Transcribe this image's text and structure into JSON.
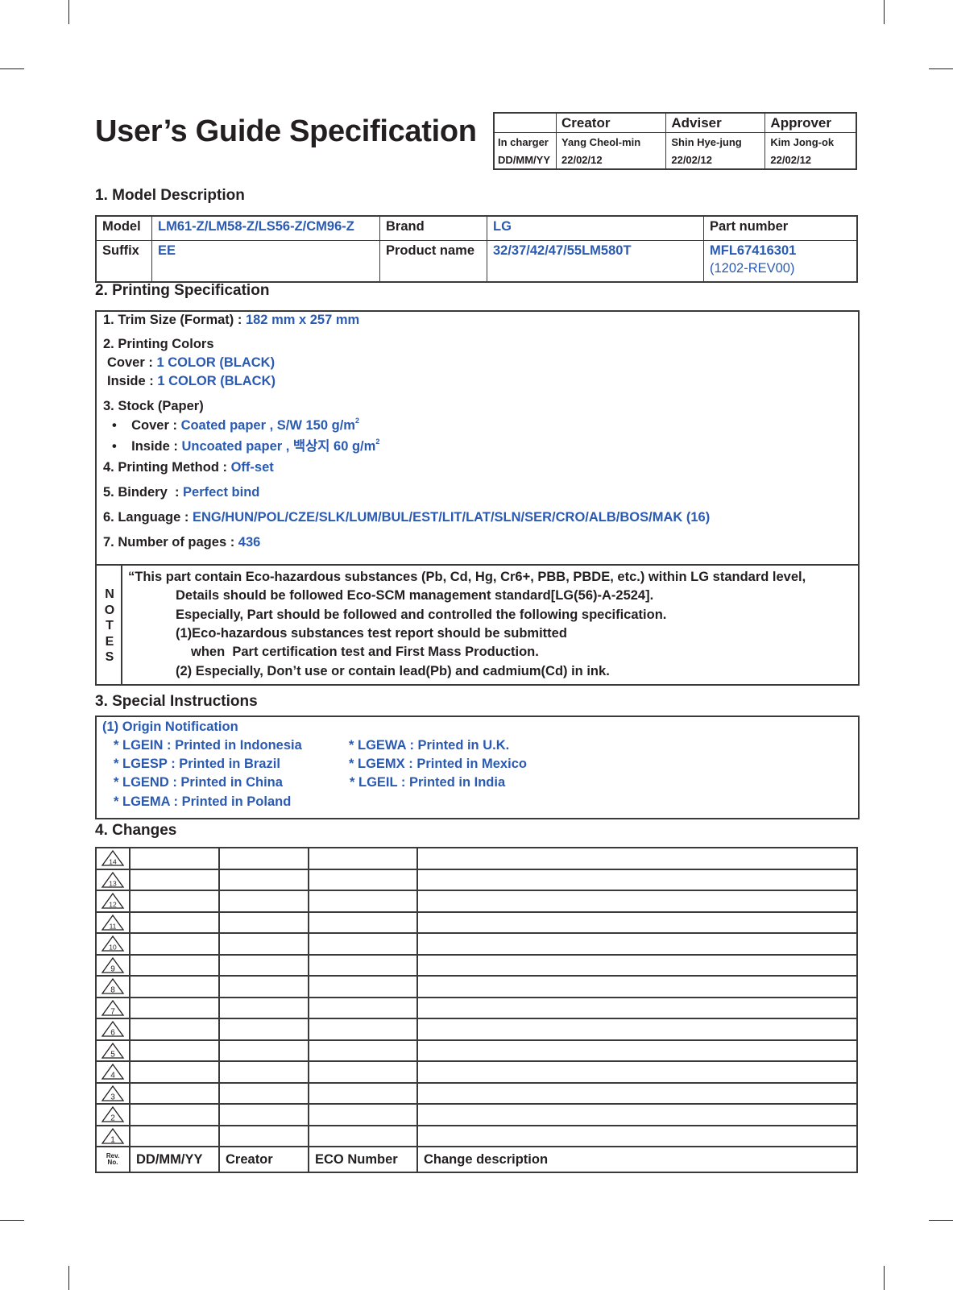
{
  "document": {
    "title": "User’s Guide Specification"
  },
  "approval": {
    "columns": [
      "",
      "Creator",
      "Adviser",
      "Approver"
    ],
    "rows": [
      {
        "label": "In charger",
        "creator": "Yang Cheol-min",
        "adviser": "Shin Hye-jung",
        "approver": "Kim Jong-ok"
      },
      {
        "label": "DD/MM/YY",
        "creator": "22/02/12",
        "adviser": "22/02/12",
        "approver": "22/02/12"
      }
    ]
  },
  "model_description": {
    "heading": "1. Model Description",
    "model_label": "Model",
    "model_value": "LM61-Z/LM58-Z/LS56-Z/CM96-Z",
    "brand_label": "Brand",
    "brand_value": "LG",
    "part_number_label": "Part number",
    "suffix_label": "Suffix",
    "suffix_value": "EE",
    "product_name_label": "Product name",
    "product_name_value": "32/37/42/47/55LM580T",
    "part_number_value": "MFL67416301",
    "part_number_rev": "(1202-REV00)"
  },
  "printing_spec": {
    "heading": "2. Printing Specification",
    "trim_label": "1. Trim Size (Format) : ",
    "trim_value": "182 mm x 257 mm",
    "colors_label": "2. Printing Colors",
    "cover_color_label": "Cover : ",
    "cover_color_value": "1 COLOR (BLACK)",
    "inside_color_label": "Inside : ",
    "inside_color_value": "1 COLOR (BLACK)",
    "stock_label": "3. Stock (Paper)",
    "stock_cover_label": "Cover : ",
    "stock_cover_value": "Coated paper , S/W 150 g/m",
    "stock_inside_label": "Inside : ",
    "stock_inside_value": "Uncoated paper , 백상지 60 g/m",
    "stock_unit_sup": "2",
    "bullet": "•",
    "method_label": "4. Printing Method : ",
    "method_value": "Off-set",
    "bindery_label": "5. Bindery  : ",
    "bindery_value": "Perfect bind",
    "language_label": "6. Language : ",
    "language_value": "ENG/HUN/POL/CZE/SLK/LUM/BUL/EST/LIT/LAT/SLN/SER/CRO/ALB/BOS/MAK (16)",
    "pages_label": "7. Number of pages : ",
    "pages_value": "436"
  },
  "notes": {
    "side_label": [
      "N",
      "O",
      "T",
      "E",
      "S"
    ],
    "lines": [
      "“This part contain Eco-hazardous substances (Pb, Cd, Hg, Cr6+, PBB, PBDE, etc.) within LG standard level,",
      "Details should be followed Eco-SCM management standard[LG(56)-A-2524].",
      "Especially, Part should be followed and controlled the following specification.",
      "(1)Eco-hazardous substances test report should be submitted",
      "when  Part certification test and First Mass Production.",
      "(2) Especially, Don’t use or contain lead(Pb) and cadmium(Cd) in ink."
    ]
  },
  "special_instructions": {
    "heading": "3. Special Instructions",
    "subheading": "(1) Origin Notification",
    "left_items": [
      "* LGEIN : Printed in Indonesia",
      "* LGESP : Printed in Brazil",
      "* LGEND : Printed in China",
      "* LGEMA : Printed in Poland"
    ],
    "right_items": [
      "* LGEWA : Printed in U.K.",
      "* LGEMX : Printed in Mexico",
      "* LGEIL : Printed in India"
    ]
  },
  "changes": {
    "heading": "4. Changes",
    "rev_numbers": [
      "14",
      "13",
      "12",
      "11",
      "10",
      "9",
      "8",
      "7",
      "6",
      "5",
      "4",
      "3",
      "2",
      "1"
    ],
    "footer": {
      "rev_label_1": "Rev.",
      "rev_label_2": "No.",
      "date": "DD/MM/YY",
      "creator": "Creator",
      "eco": "ECO Number",
      "description": "Change description"
    }
  }
}
